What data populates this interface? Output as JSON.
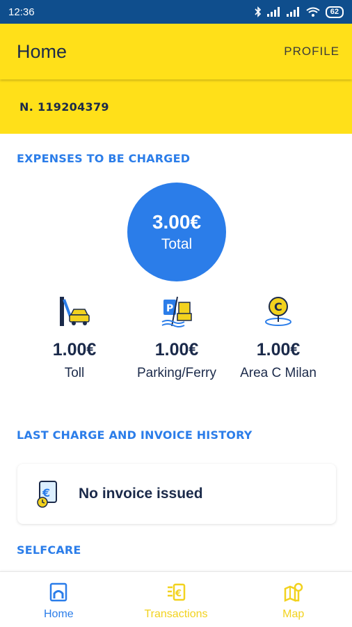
{
  "status_bar": {
    "time": "12:36",
    "battery": "62"
  },
  "header": {
    "title": "Home",
    "profile_label": "PROFILE"
  },
  "account": {
    "number": "N. 119204379"
  },
  "expenses": {
    "section_title": "EXPENSES TO BE CHARGED",
    "total_amount": "3.00€",
    "total_label": "Total",
    "items": [
      {
        "amount": "1.00€",
        "label": "Toll",
        "icon": "toll-gate-icon"
      },
      {
        "amount": "1.00€",
        "label": "Parking/Ferry",
        "icon": "parking-ferry-icon"
      },
      {
        "amount": "1.00€",
        "label": "Area C Milan",
        "icon": "area-c-pin-icon"
      }
    ]
  },
  "history": {
    "section_title": "LAST CHARGE AND INVOICE HISTORY",
    "empty_message": "No invoice issued",
    "icon": "invoice-euro-icon"
  },
  "selfcare": {
    "section_title": "SELFCARE"
  },
  "bottom_nav": {
    "items": [
      {
        "label": "Home",
        "icon": "home-icon",
        "active": true
      },
      {
        "label": "Transactions",
        "icon": "transactions-icon",
        "active": false
      },
      {
        "label": "Map",
        "icon": "map-icon",
        "active": false
      }
    ]
  },
  "colors": {
    "brand_yellow": "#ffe019",
    "accent_blue": "#2b7de9",
    "status_bar": "#0f4e8d",
    "text_navy": "#1b2a4a"
  }
}
